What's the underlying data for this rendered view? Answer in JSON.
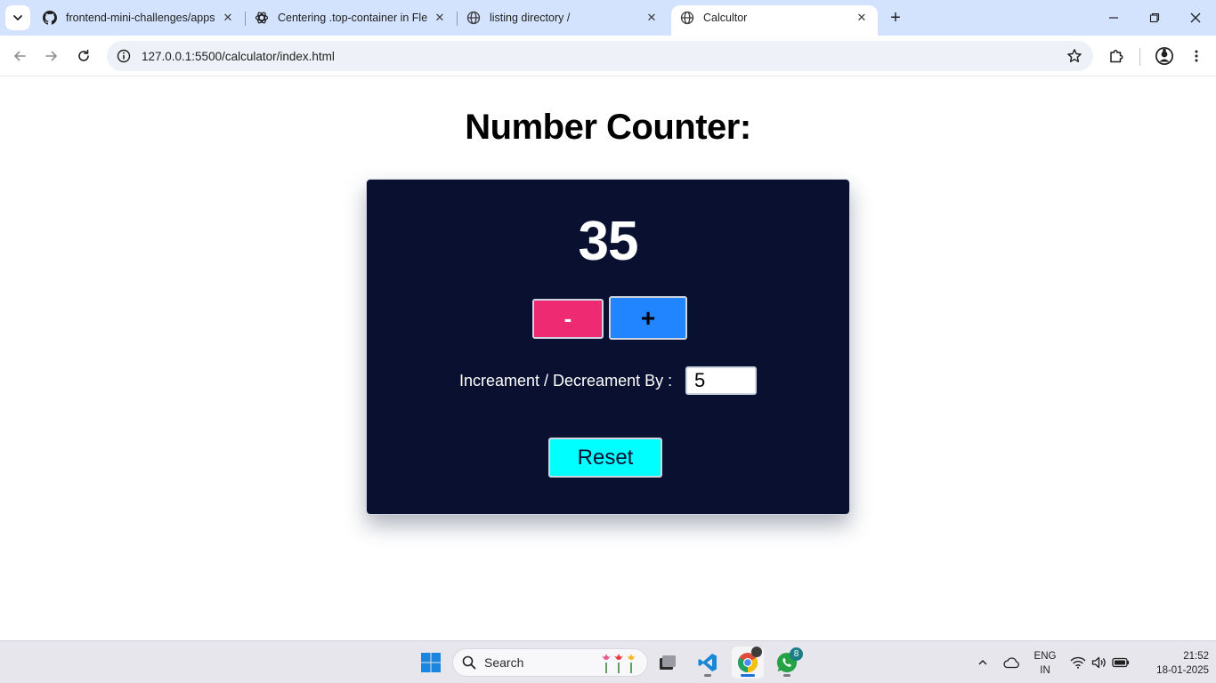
{
  "browser": {
    "tabs": [
      {
        "title": "frontend-mini-challenges/apps",
        "icon": "github-icon",
        "active": false
      },
      {
        "title": "Centering .top-container in Flex",
        "icon": "chatgpt-icon",
        "active": false
      },
      {
        "title": "listing directory /",
        "icon": "globe-icon",
        "active": false
      },
      {
        "title": "Calcultor",
        "icon": "globe-icon",
        "active": true
      }
    ],
    "url": "127.0.0.1:5500/calculator/index.html"
  },
  "page": {
    "title": "Number Counter:",
    "counter_value": "35",
    "decrement_label": "-",
    "increment_label": "+",
    "step_label": "Increament / Decreament By :",
    "step_value": "5",
    "reset_label": "Reset",
    "colors": {
      "card_bg": "#0a1130",
      "decrement_bg": "#ee2a72",
      "increment_bg": "#2185ff",
      "reset_bg": "#00ffff"
    }
  },
  "taskbar": {
    "search_placeholder": "Search",
    "whatsapp_badge": "8",
    "language_line1": "ENG",
    "language_line2": "IN",
    "time": "21:52",
    "date": "18-01-2025"
  }
}
